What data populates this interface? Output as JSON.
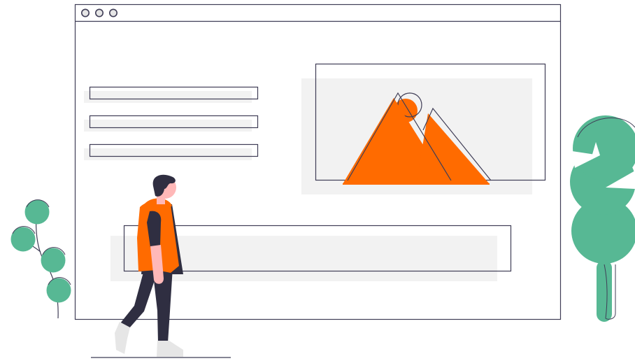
{
  "colors": {
    "outline": "#3f3d56",
    "accent": "#ff6b00",
    "placeholder": "#f2f2f2",
    "plant": "#57b894",
    "window_dot": "#3f3d56",
    "skin": "#ffb8b8",
    "hair": "#2f2e41",
    "pants": "#2f2e41",
    "shoes": "#e6e6e6"
  },
  "browser_window": {
    "control_dots": 3,
    "text_lines": 3
  },
  "icons": [
    "mountain-image-icon",
    "sun-icon",
    "plant-icon",
    "tree-icon",
    "person-walking-figure"
  ]
}
